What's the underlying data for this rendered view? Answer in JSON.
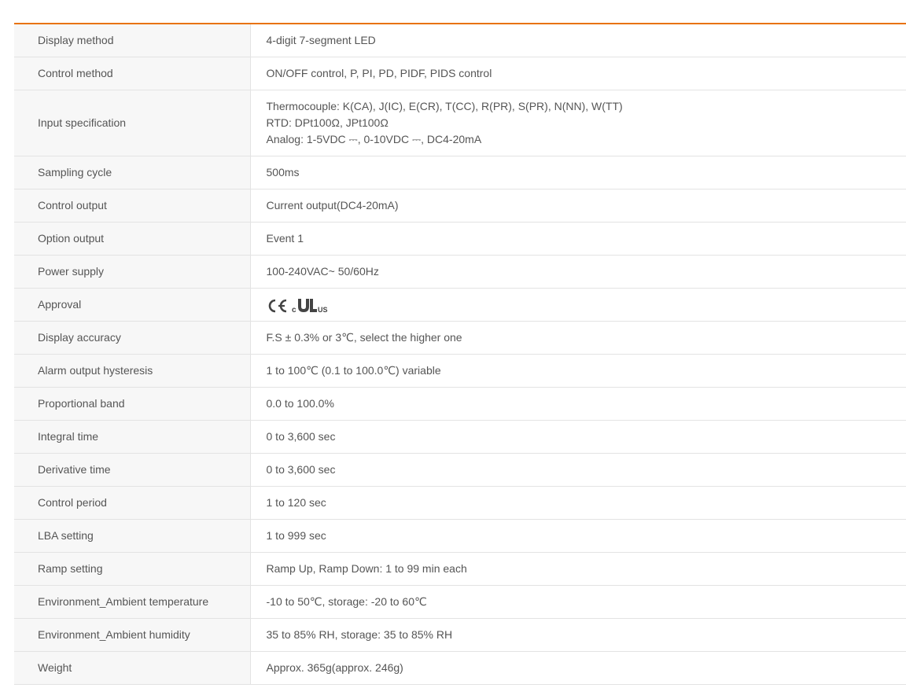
{
  "rows": [
    {
      "label": "Display method",
      "value": "4-digit 7-segment LED"
    },
    {
      "label": "Control method",
      "value": "ON/OFF control, P, PI, PD, PIDF, PIDS control"
    },
    {
      "label": "Input specification",
      "lines": [
        "Thermocouple: K(CA), J(IC), E(CR), T(CC), R(PR), S(PR), N(NN), W(TT)",
        "RTD: DPt100Ω, JPt100Ω",
        "Analog: 1-5VDC ⎓, 0-10VDC ⎓, DC4-20mA"
      ]
    },
    {
      "label": "Sampling cycle",
      "value": "500ms"
    },
    {
      "label": "Control output",
      "value": "Current output(DC4-20mA)"
    },
    {
      "label": "Option output",
      "value": "Event 1"
    },
    {
      "label": "Power supply",
      "value": "100-240VAC~ 50/60Hz"
    },
    {
      "label": "Approval",
      "icons": [
        "ce-mark-icon",
        "c-ul-us-mark-icon"
      ],
      "cert_text": {
        "c": "c",
        "us": "US"
      }
    },
    {
      "label": "Display accuracy",
      "value": "F.S ± 0.3% or 3℃, select the higher one"
    },
    {
      "label": "Alarm output hysteresis",
      "value": "1 to 100℃ (0.1 to 100.0℃) variable"
    },
    {
      "label": "Proportional band",
      "value": "0.0 to 100.0%"
    },
    {
      "label": "Integral time",
      "value": "0 to 3,600 sec"
    },
    {
      "label": "Derivative time",
      "value": "0 to 3,600 sec"
    },
    {
      "label": "Control period",
      "value": "1 to 120 sec"
    },
    {
      "label": "LBA setting",
      "value": "1 to 999 sec"
    },
    {
      "label": "Ramp setting",
      "value": "Ramp Up, Ramp Down: 1 to 99 min each"
    },
    {
      "label": "Environment_Ambient temperature",
      "value": "-10 to 50℃, storage: -20 to 60℃"
    },
    {
      "label": "Environment_Ambient humidity",
      "value": "35 to 85% RH, storage: 35 to 85% RH"
    },
    {
      "label": "Weight",
      "value": "Approx. 365g(approx. 246g)"
    }
  ],
  "colors": {
    "accent_border": "#e8730a",
    "label_bg": "#f7f7f7",
    "divider": "#e3e3e3",
    "text": "#555555"
  }
}
